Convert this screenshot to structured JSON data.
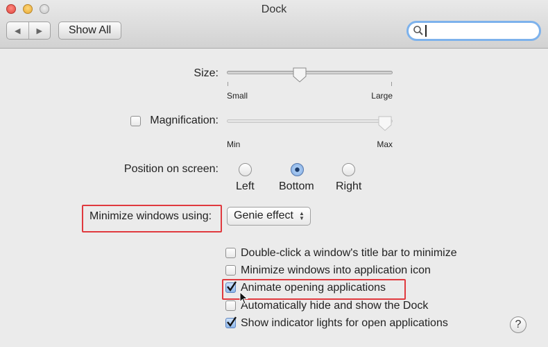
{
  "window": {
    "title": "Dock"
  },
  "toolbar": {
    "back_icon": "◀",
    "forward_icon": "▶",
    "show_all_label": "Show All",
    "search_value": ""
  },
  "size": {
    "label": "Size:",
    "min_label": "Small",
    "max_label": "Large",
    "value": 0.44
  },
  "magnification": {
    "label": "Magnification:",
    "checked": false,
    "min_label": "Min",
    "max_label": "Max",
    "value": 1.0
  },
  "position": {
    "label": "Position on screen:",
    "options": [
      {
        "label": "Left",
        "selected": false
      },
      {
        "label": "Bottom",
        "selected": true
      },
      {
        "label": "Right",
        "selected": false
      }
    ]
  },
  "minimize": {
    "label": "Minimize windows using:",
    "value": "Genie effect"
  },
  "options": [
    {
      "label": "Double-click a window's title bar to minimize",
      "checked": false
    },
    {
      "label": "Minimize windows into application icon",
      "checked": false
    },
    {
      "label": "Animate opening applications",
      "checked": true
    },
    {
      "label": "Automatically hide and show the Dock",
      "checked": false
    },
    {
      "label": "Show indicator lights for open applications",
      "checked": true
    }
  ],
  "help": {
    "label": "?"
  },
  "colors": {
    "highlight": "#e0393e",
    "focus_ring": "#7db2ec"
  }
}
